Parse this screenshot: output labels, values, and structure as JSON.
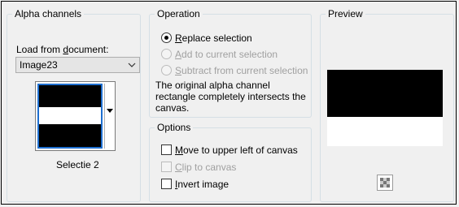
{
  "alpha": {
    "title": "Alpha channels",
    "load_label_pre": "Load from ",
    "load_label_ul": "d",
    "load_label_post": "ocument:",
    "document_value": "Image23",
    "selection_name": "Selectie 2"
  },
  "operation": {
    "title": "Operation",
    "options": [
      {
        "ul": "R",
        "rest": "eplace selection",
        "selected": true,
        "enabled": true
      },
      {
        "ul": "A",
        "rest": "dd to current selection",
        "selected": false,
        "enabled": false
      },
      {
        "ul": "S",
        "rest": "ubtract from current selection",
        "selected": false,
        "enabled": false
      }
    ],
    "description": "The original alpha channel rectangle completely intersects the canvas."
  },
  "options": {
    "title": "Options",
    "checks": [
      {
        "ul": "M",
        "rest": "ove to upper left of canvas",
        "checked": false,
        "enabled": true
      },
      {
        "ul": "C",
        "rest": "lip to canvas",
        "checked": false,
        "enabled": false
      },
      {
        "ul": "I",
        "rest": "nvert image",
        "checked": false,
        "enabled": true
      }
    ]
  },
  "preview": {
    "title": "Preview",
    "zoom_icon": "checker-zoom-icon"
  },
  "colors": {
    "accent": "#1e6fd0",
    "group_border": "#d5dfe5",
    "disabled_text": "#a0a0a0"
  }
}
